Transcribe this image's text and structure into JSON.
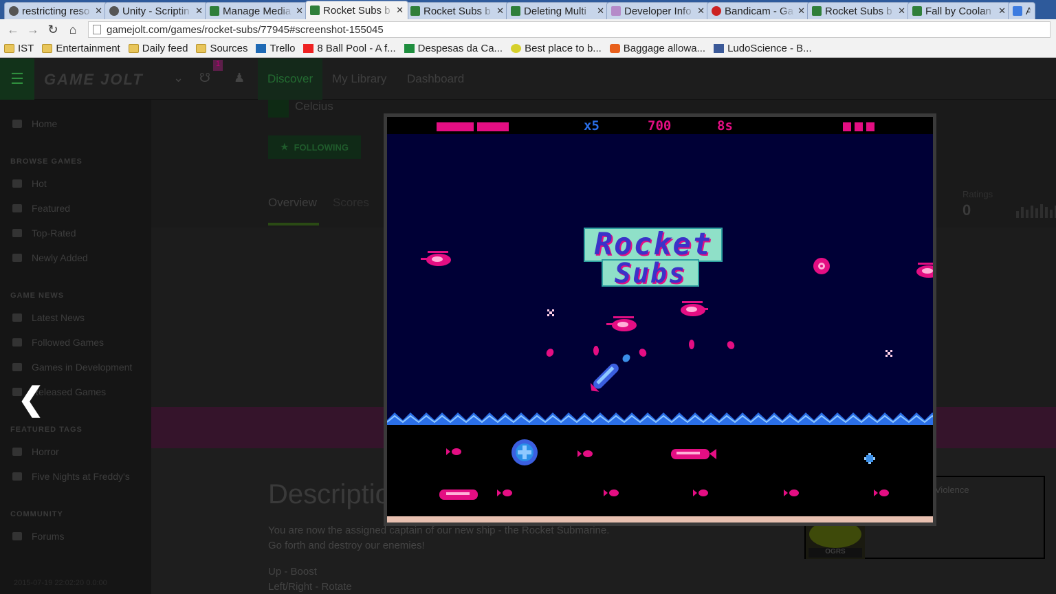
{
  "browser": {
    "tabs": [
      {
        "title": "restricting reso",
        "favicon": "gear-icon"
      },
      {
        "title": "Unity - Scriptin",
        "favicon": "unity-icon"
      },
      {
        "title": "Manage Media",
        "favicon": "gamejolt-icon"
      },
      {
        "title": "Rocket Subs b",
        "favicon": "gamejolt-icon",
        "active": true
      },
      {
        "title": "Rocket Subs b",
        "favicon": "gamejolt-icon"
      },
      {
        "title": "Deleting Multi",
        "favicon": "gamejolt-icon"
      },
      {
        "title": "Developer Info",
        "favicon": "developer-icon"
      },
      {
        "title": "Bandicam - Ga",
        "favicon": "bandicam-icon"
      },
      {
        "title": "Rocket Subs b",
        "favicon": "gamejolt-icon"
      },
      {
        "title": "Fall by Coolan",
        "favicon": "gamejolt-icon"
      },
      {
        "title": "A",
        "favicon": "google-icon"
      }
    ],
    "url": "gamejolt.com/games/rocket-subs/77945#screenshot-155045",
    "bookmarks": [
      {
        "label": "IST",
        "icon": "folder-icon"
      },
      {
        "label": "Entertainment",
        "icon": "folder-icon"
      },
      {
        "label": "Daily feed",
        "icon": "folder-icon"
      },
      {
        "label": "Sources",
        "icon": "folder-icon"
      },
      {
        "label": "Trello",
        "icon": "trello-icon"
      },
      {
        "label": "8 Ball Pool - A f...",
        "icon": "youtube-icon"
      },
      {
        "label": "Despesas da Ca...",
        "icon": "sheets-icon"
      },
      {
        "label": "Best place to b...",
        "icon": "smiley-icon"
      },
      {
        "label": "Baggage allowa...",
        "icon": "bag-icon"
      },
      {
        "label": "LudoScience - B...",
        "icon": "facebook-icon"
      }
    ]
  },
  "site": {
    "logo": "GAME JOLT",
    "notifications": "1",
    "nav": [
      "Discover",
      "My Library",
      "Dashboard"
    ],
    "sidebar": {
      "home": "Home",
      "browse_heading": "BROWSE GAMES",
      "browse": [
        "Hot",
        "Featured",
        "Top-Rated",
        "Newly Added"
      ],
      "news_heading": "GAME NEWS",
      "news": [
        "Latest News",
        "Followed Games",
        "Games in Development",
        "Released Games"
      ],
      "tags_heading": "FEATURED TAGS",
      "tags": [
        "Horror",
        "Five Nights at Freddy's"
      ],
      "community_heading": "COMMUNITY",
      "community": [
        "Forums"
      ],
      "timestamp": "2015-07-19 22:02:20 0.0:00"
    },
    "developer": "Celcius",
    "follow_label": "FOLLOWING",
    "tabs": [
      "Overview",
      "Scores"
    ],
    "ratings_label": "Ratings",
    "ratings_value": "0",
    "description_heading": "Description",
    "description_lines": [
      "You are now the assigned captain of our new ship - the Rocket Submarine.",
      "Go forth and destroy our enemies!"
    ],
    "controls": [
      "Up - Boost",
      "Left/Right - Rotate"
    ],
    "content_rating": "Violence",
    "esrb": "OGRS"
  },
  "game": {
    "multiplier": "x5",
    "score": "700",
    "timer": "8s",
    "health_bars": 2,
    "lives": 3,
    "logo_line1": "Rocket",
    "logo_line2": "Subs",
    "colors": {
      "pink": "#e40e83",
      "blue": "#3b5fe0",
      "sky": "#000036",
      "hud_blue": "#2a6fe8"
    }
  }
}
